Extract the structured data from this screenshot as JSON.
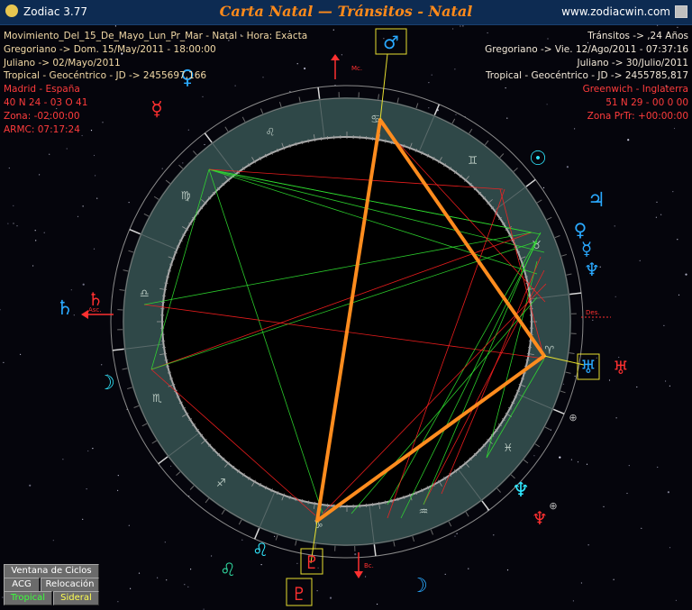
{
  "window": {
    "app_name": "Zodiac 3.77",
    "title": "Carta Natal — Tránsitos - Natal",
    "site": "www.zodiacwin.com"
  },
  "natal_info": [
    "Movimiento_Del_15_De_Mayo_Lun_Pr_Mar - Natal - Hora: Exacta",
    "Gregoriano -> Dom. 15/May/2011 - 18:00:00",
    "Juliano -> 02/Mayo/2011",
    "Tropical - Geocéntrico - JD -> 2455697,166",
    "Madrid - España",
    "40 N 24 - 03 O 41",
    "Zona: -02:00:00",
    "ARMC: 07:17:24"
  ],
  "transit_info": [
    "Tránsitos -> ,24 Años",
    "Gregoriano -> Vie. 12/Ago/2011 - 07:37:16",
    "Juliano -> 30/Julio/2011",
    "Tropical - Geocéntrico - JD -> 2455785,817",
    "Greenwich - Inglaterra",
    "51 N 29 - 00 0 00",
    "Zona PrTr: +00:00:00"
  ],
  "buttons": {
    "cycles": "Ventana de Ciclos",
    "acg": "ACG",
    "relocation": "Relocación",
    "tropical": "Tropical",
    "sidereal": "Sideral"
  },
  "chart": {
    "axis_labels": {
      "mc": "Mc.",
      "asc": "Asc.",
      "des": "Des.",
      "bc": "Bc."
    },
    "sign_glyphs": [
      "♈",
      "♉",
      "♊",
      "♋",
      "♌",
      "♍",
      "♎",
      "♏",
      "♐",
      "♑",
      "♒",
      "♓"
    ],
    "planet_glyphs": [
      {
        "name": "transit-mars",
        "glyph": "♂"
      },
      {
        "name": "transit-moon",
        "glyph": "☽"
      },
      {
        "name": "transit-leo",
        "glyph": "♌"
      },
      {
        "name": "natal-venus",
        "glyph": "♀"
      },
      {
        "name": "natal-mercury",
        "glyph": "☿"
      },
      {
        "name": "natal-sun",
        "glyph": "☉"
      },
      {
        "name": "natal-jupiter",
        "glyph": "♃"
      },
      {
        "name": "natal-neptune",
        "glyph": "♆"
      },
      {
        "name": "natal-uranus",
        "glyph": "♅"
      },
      {
        "name": "natal-pluto",
        "glyph": "♇"
      }
    ],
    "colors": {
      "ring": "#2f4848",
      "natal": "#ff3030",
      "transit": "#2aa9ff",
      "aspect_figure": "#ff8c1e",
      "trine": "#30e030",
      "square": "#ff2020",
      "marker_box": "#e8e030"
    }
  }
}
